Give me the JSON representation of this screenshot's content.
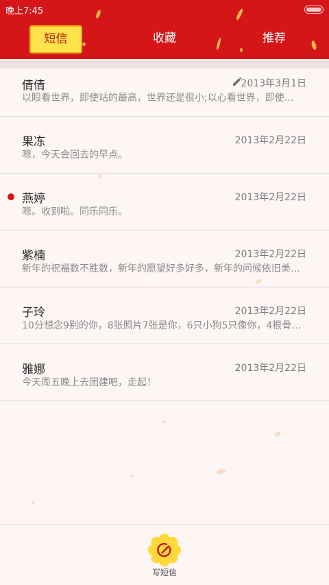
{
  "status_bar": {
    "time": "晚上7:45"
  },
  "tabs": [
    {
      "label": "短信",
      "selected": true
    },
    {
      "label": "收藏",
      "selected": false
    },
    {
      "label": "推荐",
      "selected": false
    }
  ],
  "messages": [
    {
      "contact": "倩倩",
      "date": "2013年3月1日",
      "preview": "以眼看世界，即使站的最高，世界还是很小;以心看世界，即使身…",
      "draft": true,
      "unread": false
    },
    {
      "contact": "果冻",
      "date": "2013年2月22日",
      "preview": "嗯，今天会回去的早点。",
      "draft": false,
      "unread": false
    },
    {
      "contact": "燕婷",
      "date": "2013年2月22日",
      "preview": "嗯。收到啦。同乐同乐。",
      "draft": false,
      "unread": true
    },
    {
      "contact": "紫楠",
      "date": "2013年2月22日",
      "preview": "新年的祝福数不胜数，新年的愿望好多好多，新年的问候依旧美好…",
      "draft": false,
      "unread": false
    },
    {
      "contact": "子玲",
      "date": "2013年2月22日",
      "preview": "10分想念9别的你，8张照片7张是你，6只小狗5只像你，4根骨头…",
      "draft": false,
      "unread": false
    },
    {
      "contact": "雅娜",
      "date": "2013年2月22日",
      "preview": "今天周五晚上去团建吧，走起！",
      "draft": false,
      "unread": false
    }
  ],
  "compose": {
    "label": "写短信",
    "icon": "compose-icon"
  },
  "colors": {
    "header": "#d41619",
    "tab_selected_bg": "#ffe34b",
    "unread_dot": "#d41619",
    "background": "#fdf6f5"
  }
}
